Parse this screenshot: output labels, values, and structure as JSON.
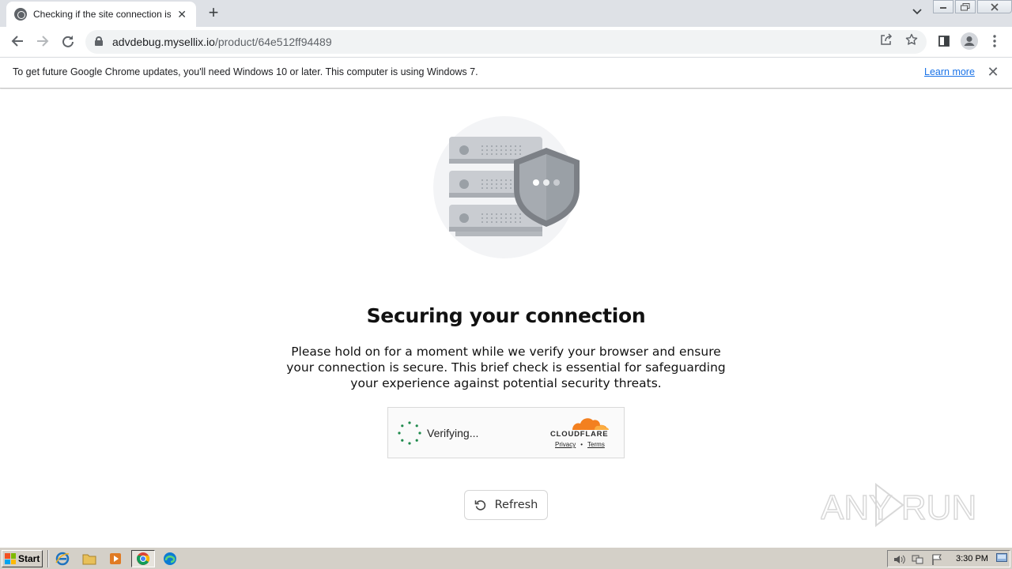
{
  "browser": {
    "tab_title": "Checking if the site connection is secure",
    "tab_close_icon": "close-icon",
    "new_tab_label": "+",
    "url_host": "advdebug.mysellix.io",
    "url_path": "/product/64e512ff94489"
  },
  "infobar": {
    "message": "To get future Google Chrome updates, you'll need Windows 10 or later. This computer is using Windows 7.",
    "link": "Learn more"
  },
  "page": {
    "headline": "Securing your connection",
    "description": "Please hold on for a moment while we verify your browser and ensure your connection is secure. This brief check is essential for safeguarding your experience against potential security threats.",
    "widget": {
      "status": "Verifying...",
      "brand": "CLOUDFLARE",
      "privacy": "Privacy",
      "separator": "•",
      "terms": "Terms"
    },
    "refresh_label": "Refresh"
  },
  "watermark": "ANY RUN",
  "taskbar": {
    "start_label": "Start",
    "clock": "3:30 PM"
  },
  "colors": {
    "link": "#1a73e8",
    "cloudflare_orange": "#f38020",
    "spinner_green": "#1f8a4c"
  }
}
